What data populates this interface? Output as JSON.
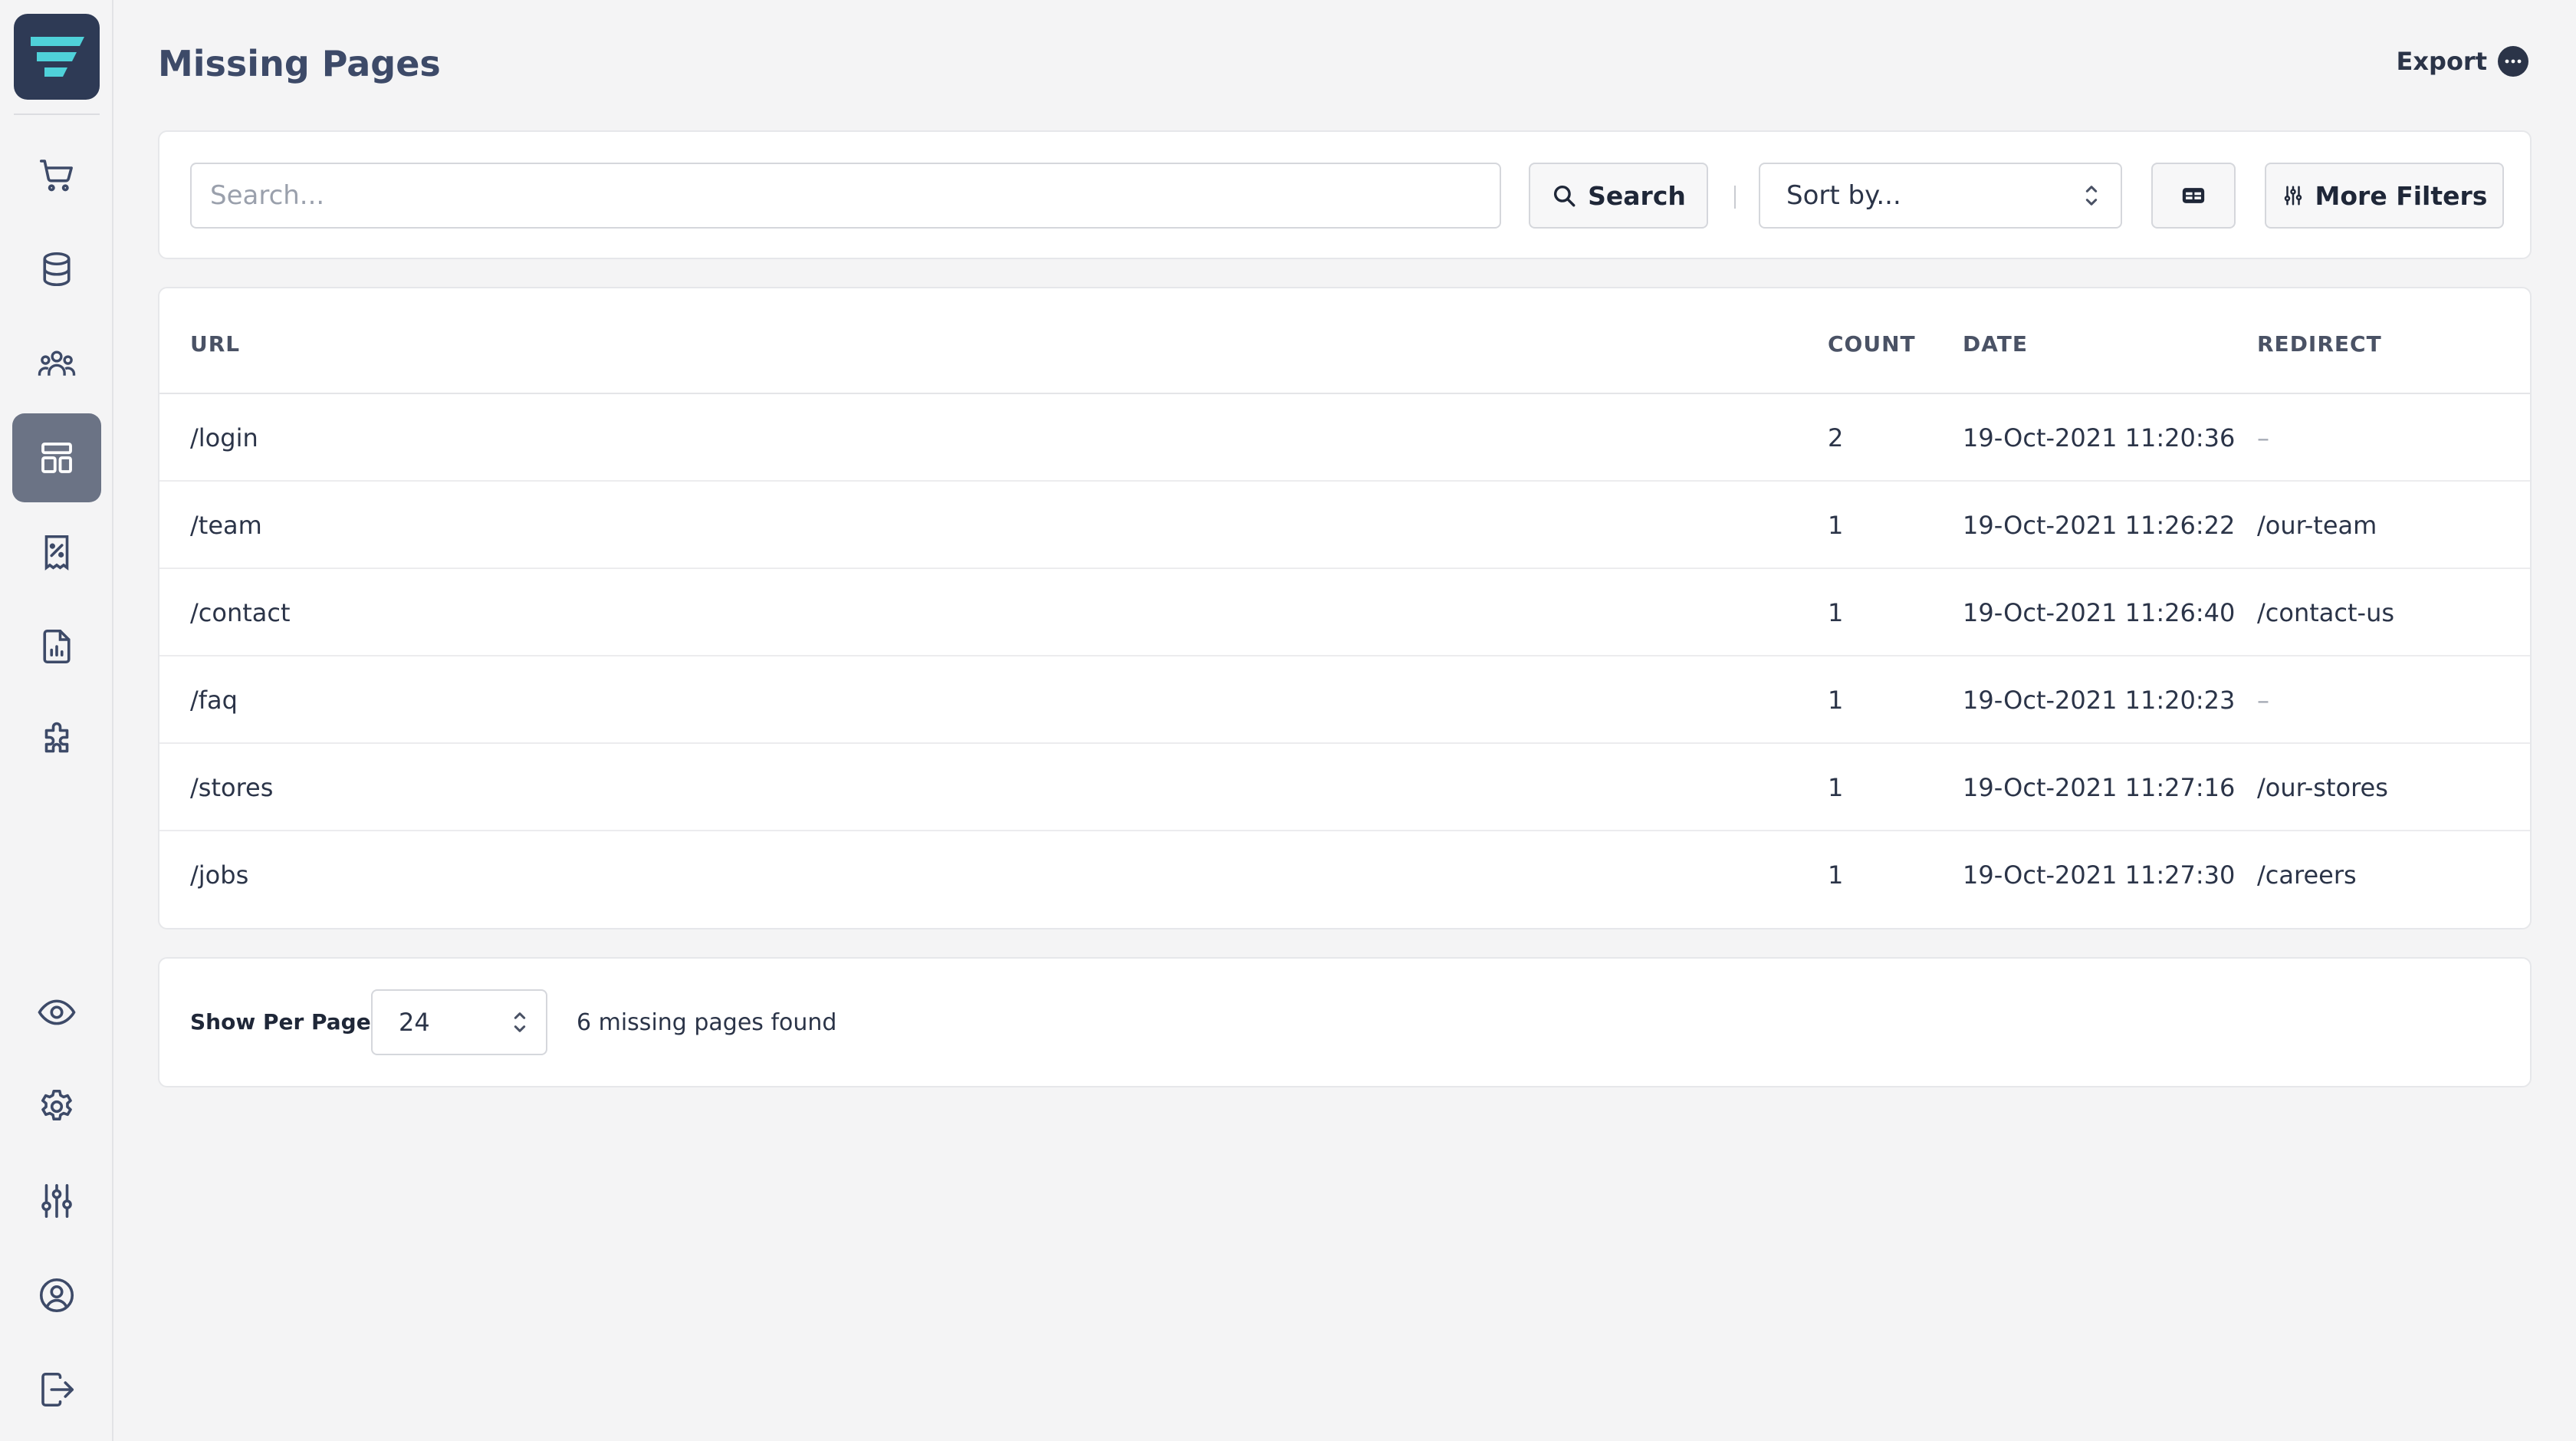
{
  "app": {
    "page_title": "Missing Pages",
    "export_label": "Export"
  },
  "sidebar": {
    "items": [
      {
        "icon": "cart-icon"
      },
      {
        "icon": "database-icon"
      },
      {
        "icon": "users-icon"
      },
      {
        "icon": "layout-icon",
        "active": true
      },
      {
        "icon": "receipt-percent-icon"
      },
      {
        "icon": "report-icon"
      },
      {
        "icon": "puzzle-icon"
      }
    ],
    "bottom_items": [
      {
        "icon": "eye-icon"
      },
      {
        "icon": "gear-icon"
      },
      {
        "icon": "sliders-icon"
      },
      {
        "icon": "user-circle-icon"
      },
      {
        "icon": "logout-icon"
      }
    ]
  },
  "toolbar": {
    "search_placeholder": "Search...",
    "search_button": "Search",
    "sort_placeholder": "Sort by...",
    "more_filters": "More Filters"
  },
  "table": {
    "headers": {
      "url": "URL",
      "count": "COUNT",
      "date": "DATE",
      "redirect": "REDIRECT"
    },
    "rows": [
      {
        "url": "/login",
        "count": "2",
        "date": "19-Oct-2021 11:20:36",
        "redirect": "–",
        "action": "add"
      },
      {
        "url": "/team",
        "count": "1",
        "date": "19-Oct-2021 11:26:22",
        "redirect": "/our-team",
        "action": "go"
      },
      {
        "url": "/contact",
        "count": "1",
        "date": "19-Oct-2021 11:26:40",
        "redirect": "/contact-us",
        "action": "go"
      },
      {
        "url": "/faq",
        "count": "1",
        "date": "19-Oct-2021 11:20:23",
        "redirect": "–",
        "action": "add"
      },
      {
        "url": "/stores",
        "count": "1",
        "date": "19-Oct-2021 11:27:16",
        "redirect": "/our-stores",
        "action": "go"
      },
      {
        "url": "/jobs",
        "count": "1",
        "date": "19-Oct-2021 11:27:30",
        "redirect": "/careers",
        "action": "go"
      }
    ]
  },
  "footer": {
    "per_page_label": "Show Per Page",
    "per_page_value": "24",
    "found_text": "6 missing pages found"
  },
  "colors": {
    "accent": "#2e3a55",
    "logo_stripes": "#4fd1d9",
    "active_nav": "#6b7385"
  }
}
